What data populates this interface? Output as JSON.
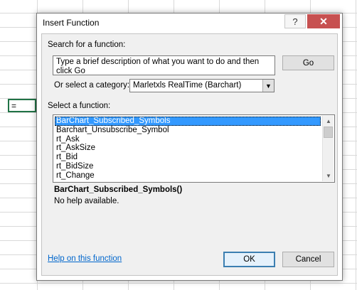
{
  "sheet": {
    "cell_value": "="
  },
  "dialog": {
    "title": "Insert Function",
    "help_icon": "?",
    "close_icon": "✕",
    "search_label": "Search for a function:",
    "search_text": "Type a brief description of what you want to do and then click Go",
    "go_label": "Go",
    "category_label": "Or select a category:",
    "category_value": "Marletxls RealTime (Barchart)",
    "select_label": "Select a function:",
    "functions": [
      "BarChart_Subscribed_Symbols",
      "Barchart_Unsubscribe_Symbol",
      "rt_Ask",
      "rt_AskSize",
      "rt_Bid",
      "rt_BidSize",
      "rt_Change"
    ],
    "selected_function": "BarChart_Subscribed_Symbols",
    "signature": "BarChart_Subscribed_Symbols()",
    "description": "No help available.",
    "help_link": "Help on this function",
    "ok_label": "OK",
    "cancel_label": "Cancel"
  }
}
